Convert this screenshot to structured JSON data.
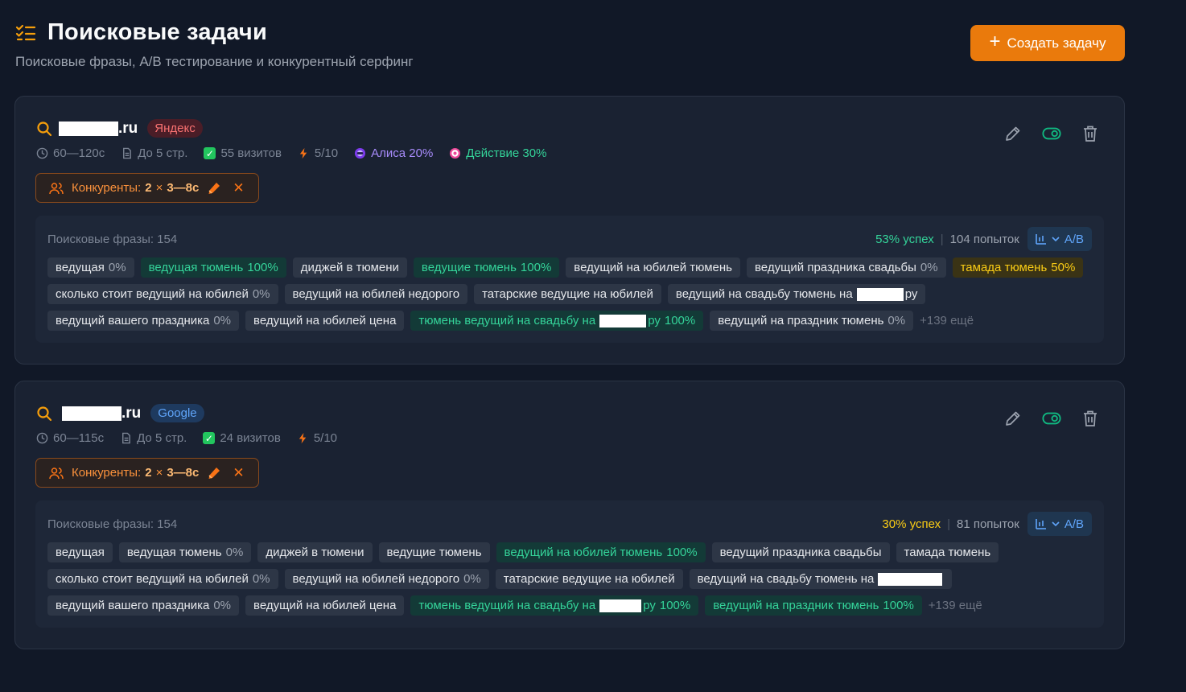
{
  "header": {
    "title": "Поисковые задачи",
    "subtitle": "Поисковые фразы, A/B тестирование и конкурентный серфинг",
    "create_button": "Создать задачу"
  },
  "colors": {
    "accent": "#ea7a0c",
    "success": "#34d399",
    "warning": "#facc15",
    "bg": "#111827"
  },
  "tasks": [
    {
      "domain_suffix": ".ru",
      "engine": "Яндекс",
      "time": "60—120с",
      "pages": "До 5 стр.",
      "visits": "55 визитов",
      "threads": "5/10",
      "alisa": "Алиса 20%",
      "action": "Действие 30%",
      "competitors_label": "Конкуренты:",
      "competitors_count": "2",
      "competitors_times": "×",
      "competitors_range": "3—8с",
      "phrases_label": "Поисковые фразы: 154",
      "success": "53% успех",
      "attempts": "104 попыток",
      "ab_label": "A/B",
      "more": "+139 ещё",
      "tags": [
        {
          "text": "ведущая",
          "pct": "0%",
          "style": "gray"
        },
        {
          "text": "ведущая тюмень",
          "pct": "100%",
          "style": "green"
        },
        {
          "text": "диджей в тюмени",
          "pct": "",
          "style": "gray"
        },
        {
          "text": "ведущие тюмень",
          "pct": "100%",
          "style": "green"
        },
        {
          "text": "ведущий на юбилей тюмень",
          "pct": "",
          "style": "gray"
        },
        {
          "text": "ведущий праздника свадьбы",
          "pct": "0%",
          "style": "gray"
        },
        {
          "text": "тамада тюмень",
          "pct": "50%",
          "style": "yellow"
        },
        {
          "text": "сколько стоит ведущий на юбилей",
          "pct": "0%",
          "style": "gray"
        },
        {
          "text": "ведущий на юбилей недорого",
          "pct": "",
          "style": "gray"
        },
        {
          "text": "татарские ведущие на юбилей",
          "pct": "",
          "style": "gray"
        },
        {
          "text": "ведущий на свадьбу тюмень на",
          "suffix": "ру",
          "pct": "",
          "style": "gray",
          "redact": 58
        },
        {
          "text": "ведущий вашего праздника",
          "pct": "0%",
          "style": "gray"
        },
        {
          "text": "ведущий на юбилей цена",
          "pct": "",
          "style": "gray"
        },
        {
          "text": "тюмень ведущий на свадьбу на",
          "suffix": "ру",
          "pct": "100%",
          "style": "green",
          "redact": 58
        },
        {
          "text": "ведущий на праздник тюмень",
          "pct": "0%",
          "style": "gray"
        }
      ]
    },
    {
      "domain_suffix": ".ru",
      "engine": "Google",
      "time": "60—115с",
      "pages": "До 5 стр.",
      "visits": "24 визитов",
      "threads": "5/10",
      "competitors_label": "Конкуренты:",
      "competitors_count": "2",
      "competitors_times": "×",
      "competitors_range": "3—8с",
      "phrases_label": "Поисковые фразы: 154",
      "success": "30% успех",
      "attempts": "81 попыток",
      "ab_label": "A/B",
      "more": "+139 ещё",
      "tags": [
        {
          "text": "ведущая",
          "pct": "",
          "style": "gray"
        },
        {
          "text": "ведущая тюмень",
          "pct": "0%",
          "style": "gray"
        },
        {
          "text": "диджей в тюмени",
          "pct": "",
          "style": "gray"
        },
        {
          "text": "ведущие тюмень",
          "pct": "",
          "style": "gray"
        },
        {
          "text": "ведущий на юбилей тюмень",
          "pct": "100%",
          "style": "green"
        },
        {
          "text": "ведущий праздника свадьбы",
          "pct": "",
          "style": "gray"
        },
        {
          "text": "тамада тюмень",
          "pct": "",
          "style": "gray"
        },
        {
          "text": "сколько стоит ведущий на юбилей",
          "pct": "0%",
          "style": "gray"
        },
        {
          "text": "ведущий на юбилей недорого",
          "pct": "0%",
          "style": "gray"
        },
        {
          "text": "татарские ведущие на юбилей",
          "pct": "",
          "style": "gray"
        },
        {
          "text": "ведущий на свадьбу тюмень на",
          "suffix": "",
          "pct": "",
          "style": "gray",
          "redact": 80
        },
        {
          "text": "ведущий вашего праздника",
          "pct": "0%",
          "style": "gray"
        },
        {
          "text": "ведущий на юбилей цена",
          "pct": "",
          "style": "gray"
        },
        {
          "text": "тюмень ведущий на свадьбу на",
          "suffix": "ру",
          "pct": "100%",
          "style": "green",
          "redact": 52
        },
        {
          "text": "ведущий на праздник тюмень",
          "pct": "100%",
          "style": "green"
        }
      ]
    }
  ]
}
